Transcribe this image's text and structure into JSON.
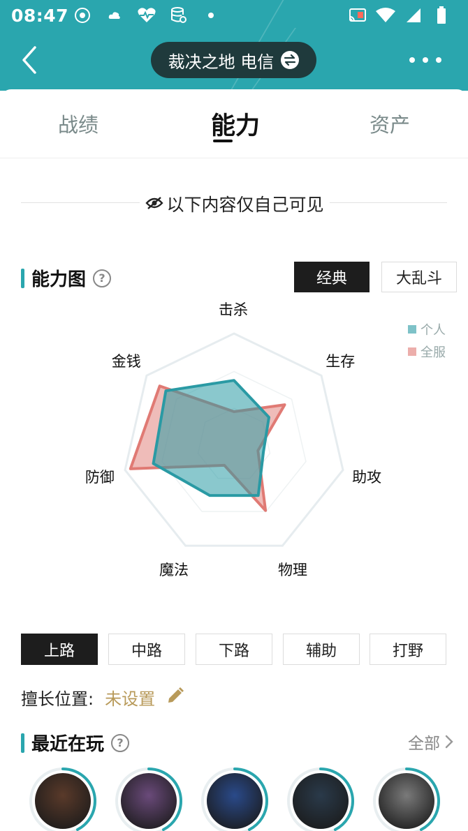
{
  "status_bar": {
    "time": "08:47"
  },
  "header": {
    "server_name": "裁决之地 电信"
  },
  "tabs": [
    {
      "label": "战绩",
      "active": false
    },
    {
      "label": "能力",
      "active": true
    },
    {
      "label": "资产",
      "active": false
    }
  ],
  "visibility_notice": "以下内容仅自己可见",
  "ability_section": {
    "title": "能力图",
    "modes": [
      {
        "label": "经典",
        "active": true
      },
      {
        "label": "大乱斗",
        "active": false
      }
    ]
  },
  "chart_data": {
    "type": "radar",
    "axes": [
      "击杀",
      "生存",
      "助攻",
      "物理",
      "魔法",
      "防御",
      "金钱"
    ],
    "series": [
      {
        "name": "个人",
        "color": "#2a9aa4",
        "values": [
          0.58,
          0.4,
          0.27,
          0.5,
          0.5,
          0.74,
          0.78
        ]
      },
      {
        "name": "全服",
        "color": "#e07a74",
        "values": [
          0.3,
          0.58,
          0.22,
          0.65,
          0.2,
          0.95,
          0.85
        ]
      }
    ],
    "max": 1
  },
  "lanes": [
    {
      "label": "上路",
      "active": true
    },
    {
      "label": "中路",
      "active": false
    },
    {
      "label": "下路",
      "active": false
    },
    {
      "label": "辅助",
      "active": false
    },
    {
      "label": "打野",
      "active": false
    }
  ],
  "position": {
    "label": "擅长位置:",
    "value": "未设置"
  },
  "recent_section": {
    "title": "最近在玩",
    "all_link": "全部"
  },
  "recent_champions": [
    {
      "icon": "champion-avatar-graves",
      "color": "#5a3a2a"
    },
    {
      "icon": "champion-avatar-irelia",
      "color": "#6a4a7a"
    },
    {
      "icon": "champion-avatar-kassadin",
      "color": "#2a4a8a"
    },
    {
      "icon": "champion-avatar-yasuo",
      "color": "#2a3a4a"
    },
    {
      "icon": "champion-avatar-riven",
      "color": "#7a7a7a"
    }
  ]
}
